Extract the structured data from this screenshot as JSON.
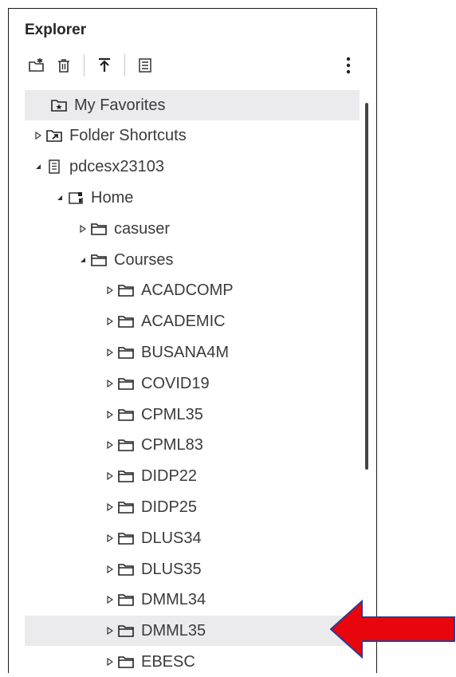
{
  "explorer": {
    "title": "Explorer",
    "toolbar": [
      {
        "name": "new-folder-icon"
      },
      {
        "name": "delete-icon"
      },
      {
        "name": "upload-icon"
      },
      {
        "name": "properties-icon"
      },
      {
        "name": "more-options-icon"
      }
    ],
    "tree": [
      {
        "label": "My Favorites",
        "level": 0,
        "toggle": "none",
        "icon": "favorites-folder-icon",
        "selected": true
      },
      {
        "label": "Folder Shortcuts",
        "level": 0,
        "toggle": "collapsed",
        "icon": "shortcut-folder-icon"
      },
      {
        "label": "pdcesx23103",
        "level": 0,
        "toggle": "expanded",
        "icon": "server-icon"
      },
      {
        "label": "Home",
        "level": 1,
        "toggle": "expanded",
        "icon": "home-folder-icon"
      },
      {
        "label": "casuser",
        "level": 2,
        "toggle": "collapsed",
        "icon": "folder-icon"
      },
      {
        "label": "Courses",
        "level": 2,
        "toggle": "expanded",
        "icon": "folder-icon"
      },
      {
        "label": "ACADCOMP",
        "level": 3,
        "toggle": "collapsed",
        "icon": "folder-icon"
      },
      {
        "label": "ACADEMIC",
        "level": 3,
        "toggle": "collapsed",
        "icon": "folder-icon"
      },
      {
        "label": "BUSANA4M",
        "level": 3,
        "toggle": "collapsed",
        "icon": "folder-icon"
      },
      {
        "label": "COVID19",
        "level": 3,
        "toggle": "collapsed",
        "icon": "folder-icon"
      },
      {
        "label": "CPML35",
        "level": 3,
        "toggle": "collapsed",
        "icon": "folder-icon"
      },
      {
        "label": "CPML83",
        "level": 3,
        "toggle": "collapsed",
        "icon": "folder-icon"
      },
      {
        "label": "DIDP22",
        "level": 3,
        "toggle": "collapsed",
        "icon": "folder-icon"
      },
      {
        "label": "DIDP25",
        "level": 3,
        "toggle": "collapsed",
        "icon": "folder-icon"
      },
      {
        "label": "DLUS34",
        "level": 3,
        "toggle": "collapsed",
        "icon": "folder-icon"
      },
      {
        "label": "DLUS35",
        "level": 3,
        "toggle": "collapsed",
        "icon": "folder-icon"
      },
      {
        "label": "DMML34",
        "level": 3,
        "toggle": "collapsed",
        "icon": "folder-icon"
      },
      {
        "label": "DMML35",
        "level": 3,
        "toggle": "collapsed",
        "icon": "folder-icon",
        "highlighted": true
      },
      {
        "label": "EBESC",
        "level": 3,
        "toggle": "collapsed",
        "icon": "folder-icon"
      }
    ]
  },
  "annotation": {
    "icon": "red-arrow-icon",
    "color": "#e8060c",
    "border": "#2f3a8f"
  }
}
